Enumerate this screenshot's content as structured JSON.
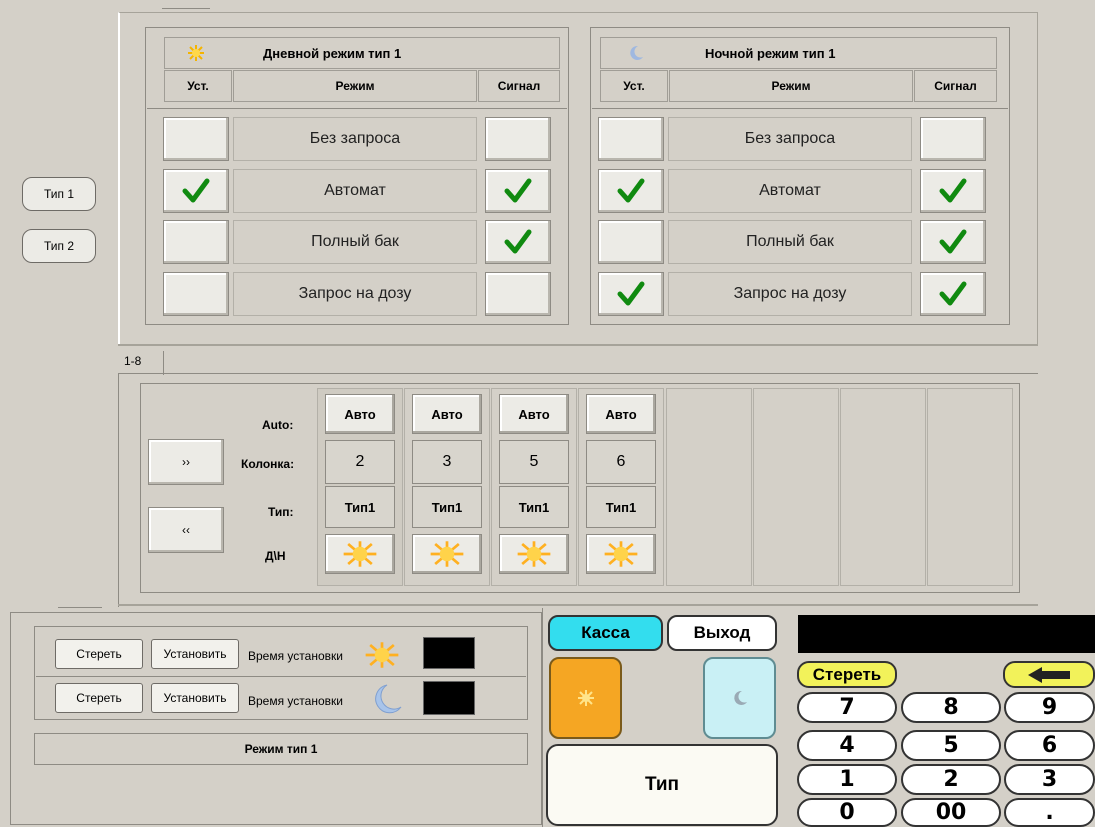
{
  "left_buttons": [
    {
      "label": "Тип 1"
    },
    {
      "label": "Тип 2"
    }
  ],
  "day_panel": {
    "title": "Дневной режим тип 1",
    "col_set": "Уст.",
    "col_mode": "Режим",
    "col_signal": "Сигнал",
    "rows": [
      {
        "mode": "Без запроса",
        "set": false,
        "signal": false
      },
      {
        "mode": "Автомат",
        "set": true,
        "signal": true
      },
      {
        "mode": "Полный бак",
        "set": false,
        "signal": true
      },
      {
        "mode": "Запрос на дозу",
        "set": false,
        "signal": false
      }
    ]
  },
  "night_panel": {
    "title": "Ночной режим тип 1",
    "col_set": "Уст.",
    "col_mode": "Режим",
    "col_signal": "Сигнал",
    "rows": [
      {
        "mode": "Без запроса",
        "set": false,
        "signal": false
      },
      {
        "mode": "Автомат",
        "set": true,
        "signal": true
      },
      {
        "mode": "Полный бак",
        "set": false,
        "signal": true
      },
      {
        "mode": "Запрос на дозу",
        "set": true,
        "signal": true
      }
    ]
  },
  "range_tab": "1-8",
  "columns_panel": {
    "next_label": "››",
    "prev_label": "‹‹",
    "row_labels": {
      "auto": "Auto:",
      "column": "Колонка:",
      "type": "Тип:",
      "daynight": "Д\\Н"
    },
    "columns": [
      {
        "auto": "Авто",
        "number": "2",
        "type": "Тип1",
        "mode": "sun-icon"
      },
      {
        "auto": "Авто",
        "number": "3",
        "type": "Тип1",
        "mode": "sun-icon"
      },
      {
        "auto": "Авто",
        "number": "5",
        "type": "Тип1",
        "mode": "sun-icon"
      },
      {
        "auto": "Авто",
        "number": "6",
        "type": "Тип1",
        "mode": "sun-icon"
      }
    ]
  },
  "time_panel": {
    "rows": [
      {
        "clear": "Стереть",
        "set": "Установить",
        "label": "Время установки",
        "icon": "sun-icon"
      },
      {
        "clear": "Стереть",
        "set": "Установить",
        "label": "Время установки",
        "icon": "moon-icon"
      }
    ],
    "footer": "Режим тип 1"
  },
  "action_panel": {
    "kassa": "Касса",
    "exit": "Выход",
    "type": "Тип",
    "colors": {
      "kassa": "#33ddee",
      "day": "#f5a623",
      "night": "#c9f0f5"
    }
  },
  "keypad": {
    "clear": "Стереть",
    "keys": [
      "7",
      "8",
      "9",
      "4",
      "5",
      "6",
      "1",
      "2",
      "3",
      "0",
      "00",
      "."
    ]
  }
}
